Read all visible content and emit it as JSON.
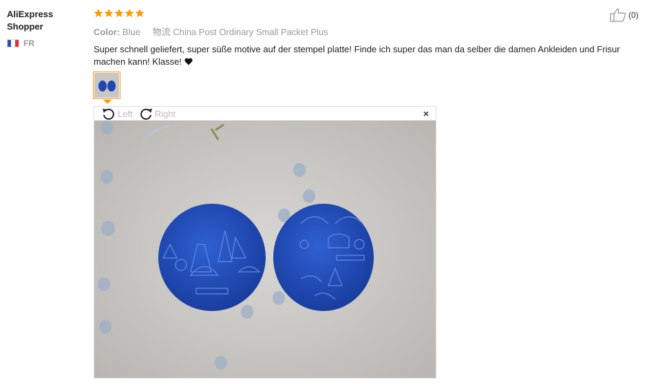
{
  "author": {
    "name": "AliExpress Shopper",
    "country": "FR"
  },
  "review": {
    "rating": 5,
    "color_label": "Color:",
    "color_value": "Blue",
    "shipping_label": "物流",
    "shipping_value": "China Post Ordinary Small Packet Plus",
    "text": "Super schnell geliefert, super süße motive auf der stempel platte! Finde ich super das man da selber die damen Ankleiden und Frisur machen kann! Klasse!"
  },
  "helpful": {
    "count": "(0)"
  },
  "viewer": {
    "rotate_left_label": "Left",
    "rotate_right_label": "Right",
    "close_label": "×"
  },
  "colors": {
    "star": "#ff9900",
    "accent": "#ff9900",
    "plate": "#1f46b2"
  },
  "icons": [
    "star-icon",
    "thumbs-up-icon",
    "heart-icon",
    "rotate-left-icon",
    "rotate-right-icon",
    "close-icon",
    "flag-icon"
  ]
}
